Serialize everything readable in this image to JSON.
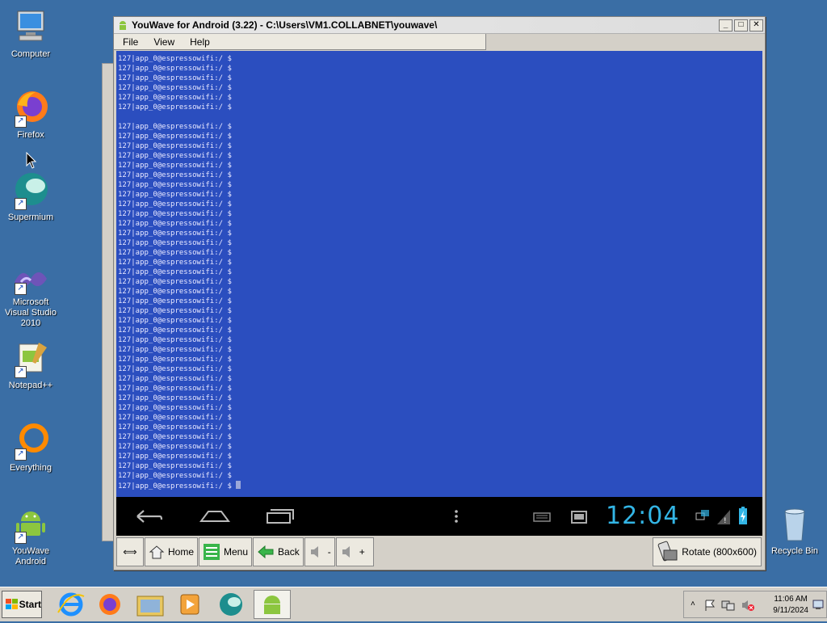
{
  "desktop": {
    "icons": [
      {
        "label": "Computer"
      },
      {
        "label": "Firefox"
      },
      {
        "label": "Supermium"
      },
      {
        "label": "Microsoft Visual Studio 2010"
      },
      {
        "label": "Notepad++"
      },
      {
        "label": "Everything"
      },
      {
        "label": "YouWave Android"
      }
    ],
    "recycle_bin": "Recycle Bin"
  },
  "window": {
    "title": "YouWave for Android (3.22) - C:\\Users\\VM1.COLLABNET\\youwave\\",
    "menu": [
      "File",
      "View",
      "Help"
    ]
  },
  "terminal": {
    "prompt": "127|app_0@espressowifi:/ $",
    "group1_count": 6,
    "group2_count": 38
  },
  "android": {
    "clock": "12:04"
  },
  "toolbar": {
    "home": "Home",
    "menu": "Menu",
    "back": "Back",
    "vol_down": "-",
    "vol_up": "+",
    "rotate": "Rotate (800x600)"
  },
  "taskbar": {
    "start": "Start",
    "time": "11:06 AM",
    "date": "9/11/2024"
  },
  "colors": {
    "desktop": "#3a6ea5",
    "terminal_bg": "#2b4ebf",
    "clock": "#33b5e5"
  }
}
